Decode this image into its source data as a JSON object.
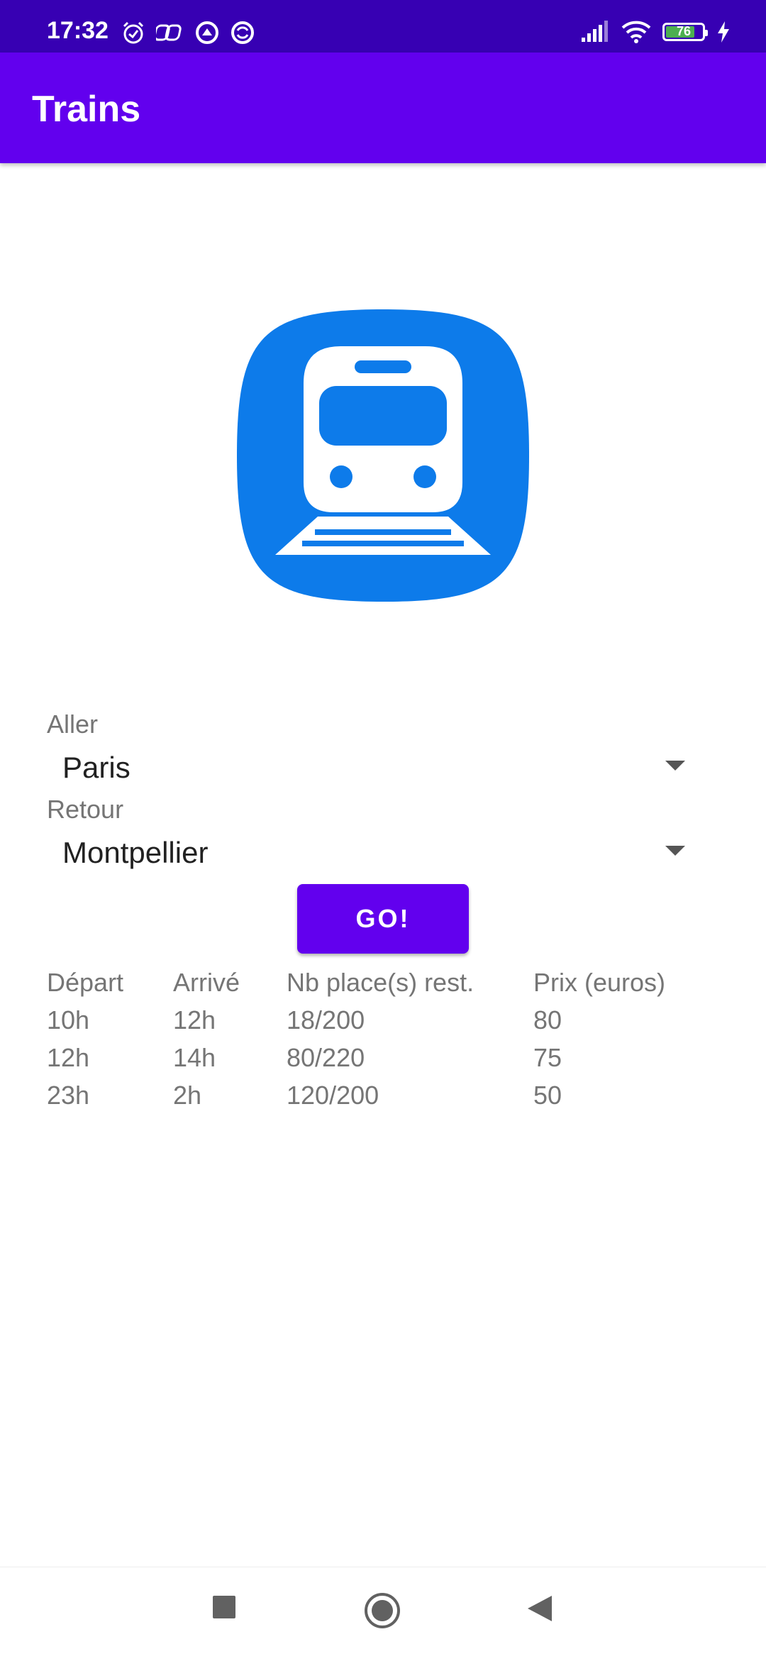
{
  "status_bar": {
    "time": "17:32",
    "battery_level": "76",
    "icons": [
      "alarm-icon",
      "link-icon",
      "vpn-icon",
      "sync-icon",
      "signal-icon",
      "wifi-icon",
      "battery-icon",
      "charging-icon"
    ],
    "bg_color": "#3700b3"
  },
  "app_bar": {
    "title": "Trains",
    "bg_color": "#6200ee"
  },
  "logo": {
    "icon": "train-icon",
    "color": "#0d7bea"
  },
  "form": {
    "aller_label": "Aller",
    "aller_value": "Paris",
    "retour_label": "Retour",
    "retour_value": "Montpellier",
    "go_label": "GO!"
  },
  "table": {
    "headers": [
      "Départ",
      "Arrivé",
      "Nb place(s) rest.",
      "Prix (euros)"
    ],
    "rows": [
      [
        "10h",
        "12h",
        "18/200",
        "80"
      ],
      [
        "12h",
        "14h",
        "80/220",
        "75"
      ],
      [
        "23h",
        "2h",
        "120/200",
        "50"
      ]
    ]
  },
  "nav_bar": {
    "icons": [
      "recents-square-icon",
      "home-circle-icon",
      "back-triangle-icon"
    ]
  }
}
